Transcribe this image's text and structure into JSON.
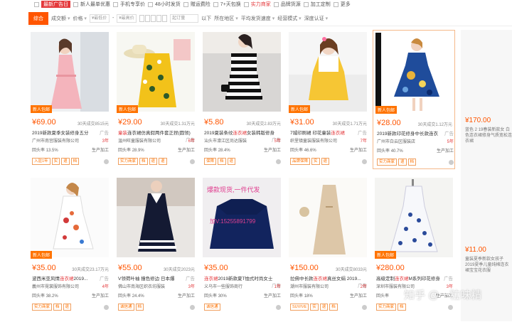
{
  "filters_top": {
    "items": [
      {
        "label": "",
        "badge": "最新广告日",
        "red": true
      },
      {
        "label": "新人最单优惠"
      },
      {
        "label": "手机专享价"
      },
      {
        "label": "48小时发货"
      },
      {
        "label": "赠运费险"
      },
      {
        "label": "7+天包换"
      },
      {
        "label": "实力商家",
        "red": true
      },
      {
        "label": "品牌货源"
      },
      {
        "label": "加工定制"
      },
      {
        "label": "更多"
      }
    ]
  },
  "sort_bar": {
    "active": "综合",
    "sales": "成交额",
    "price": "价格",
    "price_min_placeholder": "¥最低价",
    "price_max_placeholder": "¥最高价",
    "moq": "起订量",
    "below": "以下",
    "region": "所在地区",
    "rating": "平均发货速度",
    "mode": "经营模式",
    "cert": "深度认证"
  },
  "products": [
    {
      "price": "¥69.00",
      "sold": "30天成交8515元",
      "title_pre": "2019新款夏季女装修身五分",
      "title_kw": "",
      "ad": "广告",
      "shop": "广州市南宫服装有限公司",
      "lv": "3年",
      "meta_l": "回头率",
      "meta_pct": "13.5%",
      "meta_r": "生产加工",
      "badge": "新人包邮",
      "tags": [
        "入驻1年",
        "实",
        "退",
        "档"
      ],
      "img": "pink"
    },
    {
      "price": "¥29.00",
      "sold": "30天成交1.31万元",
      "title_pre": "",
      "title_kw": "童装",
      "title_post": "连衣裙仿真假两件套正捏(圆领)",
      "ad": "广告",
      "shop": "温州旺童服装有限公司",
      "lv": "6年",
      "meta_l": "回头率",
      "meta_pct": "28.9%",
      "meta_r": "生产加工",
      "badge": "新人包邮",
      "tags": [
        "实力商家",
        "档",
        "退",
        "退"
      ],
      "img": "yellow"
    },
    {
      "price": "¥5.80",
      "sold": "30天成交2.83万元",
      "title_pre": "2019夏装条纹",
      "title_kw": "连衣裙",
      "title_post": "女装韩版修身",
      "ad": "广告",
      "shop": "汕头市濠江区尚达服装",
      "lv": "5年",
      "meta_l": "回头率",
      "meta_pct": "28.4%",
      "meta_r": "生产加工",
      "badge": "",
      "tags": [
        "保障",
        "档",
        "退"
      ],
      "img": "stripe"
    },
    {
      "price": "¥31.00",
      "sold": "30天成交1.71万元",
      "title_pre": "7城印刷裙 印花童装",
      "title_kw": "连衣裙",
      "title_post": "",
      "ad": "广告",
      "shop": "织里镇童装服装有限公司",
      "lv": "7年",
      "meta_l": "回头率",
      "meta_pct": "46.6%",
      "meta_r": "生产加工",
      "badge": "新人包邮",
      "tags": [
        "品牌保障",
        "实",
        "退"
      ],
      "img": "kid"
    },
    {
      "price": "¥28.00",
      "sold": "30天成交1.12万元",
      "title_pre": "2019新款印花修身中长款连衣",
      "title_kw": "",
      "ad": "广告",
      "shop": "广州市白云区服装店",
      "lv": "5年",
      "meta_l": "回头率",
      "meta_pct": "40.7%",
      "meta_r": "生产加工",
      "badge": "新人包邮",
      "tags": [
        "实力商家",
        "退",
        "档"
      ],
      "img": "blue",
      "highlight": true
    },
    {
      "price": "¥35.00",
      "sold": "30天成交23.17万元",
      "title_pre": "波西米亚风情",
      "title_kw": "连衣裙",
      "title_post": "2019...",
      "ad": "广告",
      "shop": "義州市霓裳服饰有限公司",
      "lv": "4年",
      "meta_l": "回头率",
      "meta_pct": "38.2%",
      "meta_r": "生产加工",
      "badge": "新人包邮",
      "tags": [
        "实力商家",
        "档",
        "退"
      ],
      "img": "floral"
    },
    {
      "price": "¥55.00",
      "sold": "30天成交2023元",
      "title_pre": "V领荷叶袖 撞色修边 日本爆",
      "title_kw": "",
      "ad": "广告",
      "shop": "佛山市南海区织衣坊服装",
      "lv": "3年",
      "meta_l": "回头率",
      "meta_pct": "24.4%",
      "meta_r": "生产加工",
      "badge": "",
      "tags": [
        "诚信通",
        "档"
      ],
      "img": "navy"
    },
    {
      "price": "¥35.00",
      "sold": "",
      "title_pre": "",
      "title_kw": "连衣裙",
      "title_post": "2019新款夏T恤式时尚女士",
      "ad": "广告",
      "shop": "义乌市一些服饰商行",
      "lv": "1年",
      "meta_l": "回头率",
      "meta_pct": "30%",
      "meta_r": "生产加工",
      "badge": "",
      "tags": [
        "诚信通"
      ],
      "img": "tee"
    },
    {
      "price": "¥150.00",
      "sold": "30天成交8033元",
      "title_pre": "拉佛中长款",
      "title_kw": "连衣裙",
      "title_post": "真丝女绢 2019...",
      "ad": "广告",
      "shop": "潮州市服装有限公司",
      "lv": "2年",
      "meta_l": "回头率",
      "meta_pct": "18%",
      "meta_r": "生产加工",
      "badge": "",
      "tags": [
        "SUVIVE",
        "实",
        "退",
        "档"
      ],
      "img": "beige"
    },
    {
      "price": "¥280.00",
      "sold": "",
      "title_pre": "高级定制",
      "title_kw": "连衣裙",
      "title_post": "M系列印花修身",
      "ad": "广告",
      "shop": "深圳市服装有限公司",
      "lv": "3年",
      "meta_l": "回头率",
      "meta_pct": "",
      "meta_r": "生产加工",
      "badge": "新人包邮",
      "tags": [
        "实力商家",
        "档"
      ],
      "img": "porcelain"
    }
  ],
  "side": [
    {
      "price": "¥170.00",
      "text": "蓝色 2 19春装新款女 白色连衣裙修身气质宽松连衣裙"
    },
    {
      "price": "¥11.00",
      "text": "童装夏季新款女孩子2019夏季儿童纯棉连衣裙宝宝花衣服"
    }
  ],
  "overlay_text": {
    "line1": "爆款现货,一件代发",
    "line2": "加V:15255891799"
  },
  "watermark": "知乎 @一粒味精"
}
